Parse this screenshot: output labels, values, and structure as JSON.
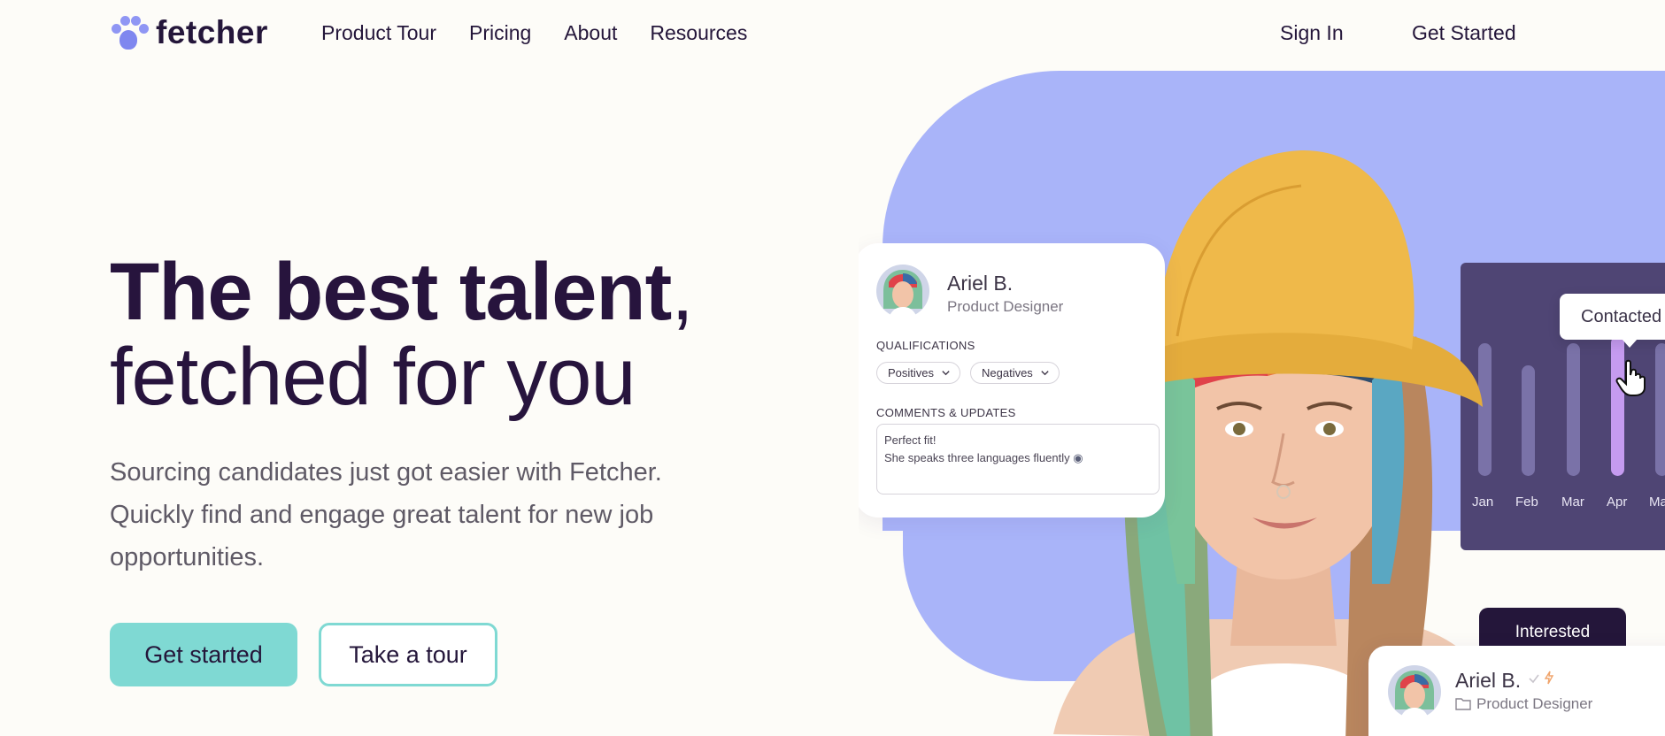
{
  "brand": {
    "name": "fetcher"
  },
  "nav": {
    "links": [
      "Product Tour",
      "Pricing",
      "About",
      "Resources"
    ],
    "sign_in": "Sign In",
    "get_started": "Get Started"
  },
  "hero": {
    "headline_bold": "The best talent",
    "headline_comma": ",",
    "headline_line2": "fetched for you",
    "lead": "Sourcing candidates just got easier with Fetcher. Quickly find and engage great talent for new job opportunities.",
    "cta_primary": "Get started",
    "cta_secondary": "Take a tour"
  },
  "profile_card": {
    "name": "Ariel B.",
    "role": "Product Designer",
    "qualifications_label": "QUALIFICATIONS",
    "chips": [
      "Positives",
      "Negatives"
    ],
    "comments_label": "COMMENTS & UPDATES",
    "comment_line1": "Perfect fit!",
    "comment_line2": "She speaks three languages fluently"
  },
  "activity_chart": {
    "months": [
      "Jan",
      "Feb",
      "Mar",
      "Apr",
      "Ma"
    ],
    "tooltip": "Contacted",
    "active_month": "Apr"
  },
  "status_card": {
    "tooltip": "Interested",
    "name": "Ariel B.",
    "role": "Product Designer"
  },
  "colors": {
    "background": "#fdfcf8",
    "brand_dark": "#24163a",
    "accent_teal": "#7fd9d3",
    "blob_periwinkle": "#a9b4f9",
    "chart_panel": "#4f4574"
  }
}
